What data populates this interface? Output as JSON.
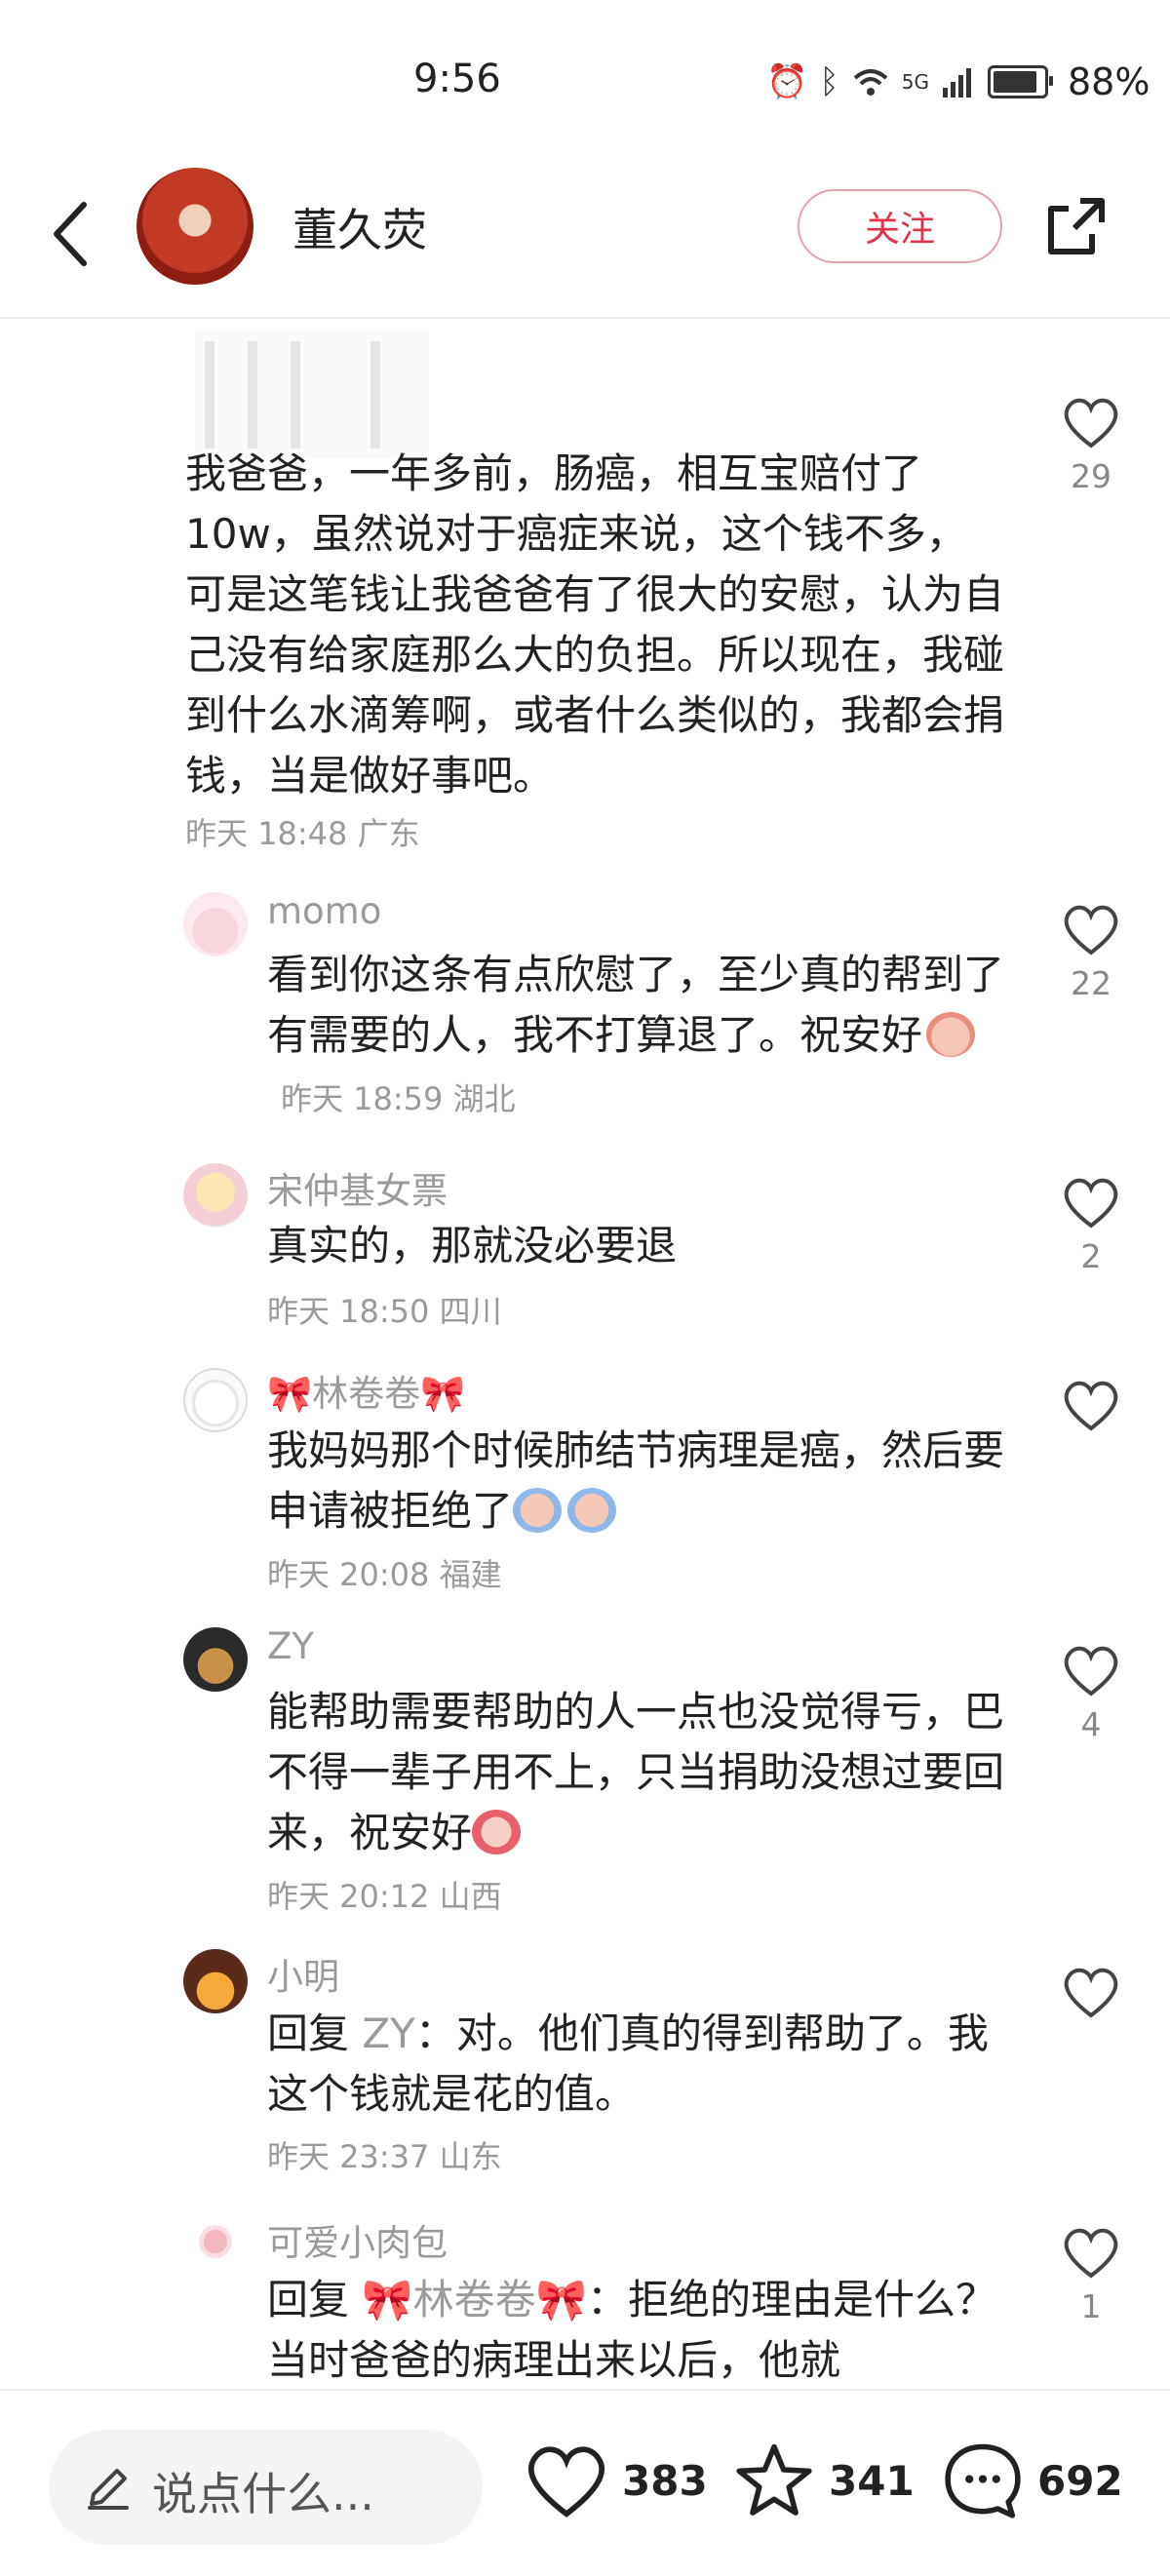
{
  "status_bar": {
    "time": "9:56",
    "network": "5G",
    "battery_percent": "88%",
    "battery_level": 0.88
  },
  "header": {
    "author_name": "董久荧",
    "follow_label": "关注"
  },
  "comments": [
    {
      "user": "",
      "text": "我爸爸，一年多前，肠癌，相互宝赔付了10w，虽然说对于癌症来说，这个钱不多，可是这笔钱让我爸爸有了很大的安慰，认为自己没有给家庭那么大的负担。所以现在，我碰到什么水滴筹啊，或者什么类似的，我都会捐钱，当是做好事吧。",
      "meta": "昨天 18:48 广东",
      "likes": "29"
    },
    {
      "user": "momo",
      "text": "看到你这条有点欣慰了，至少真的帮到了有需要的人，我不打算退了。祝安好",
      "meta": "昨天 18:59 湖北",
      "likes": "22"
    },
    {
      "user": "宋仲基女票",
      "text": "真实的，那就没必要退",
      "meta": "昨天 18:50 四川",
      "likes": "2"
    },
    {
      "user_prefix": "🎀",
      "user": "林卷卷",
      "user_suffix": "🎀",
      "text": "我妈妈那个时候肺结节病理是癌，然后要申请被拒绝了",
      "meta": "昨天 20:08 福建",
      "likes": ""
    },
    {
      "user": "ZY",
      "text": "能帮助需要帮助的人一点也没觉得亏，巴不得一辈子用不上，只当捐助没想过要回来，祝安好",
      "meta": "昨天 20:12 山西",
      "likes": "4"
    },
    {
      "user": "小明",
      "reply_label": "回复",
      "reply_to": "ZY",
      "text": "：对。他们真的得到帮助了。我这个钱就是花的值。",
      "meta": "昨天 23:37 山东",
      "likes": ""
    },
    {
      "user": "可爱小肉包",
      "reply_label": "回复",
      "reply_to_prefix": "🎀",
      "reply_to": "林卷卷",
      "reply_to_suffix": "🎀",
      "text": "：拒绝的理由是什么？当时爸爸的病理出来以后，他就",
      "likes": "1"
    }
  ],
  "bottom_bar": {
    "input_placeholder": "说点什么...",
    "like_count": "383",
    "favorite_count": "341",
    "comment_count": "692"
  },
  "colors": {
    "follow": "#e0344a",
    "meta_gray": "#9a9a9a",
    "icon": "#333333"
  },
  "icons": [
    "back-icon",
    "share-icon",
    "heart-icon",
    "star-icon",
    "comment-icon",
    "pen-icon"
  ]
}
